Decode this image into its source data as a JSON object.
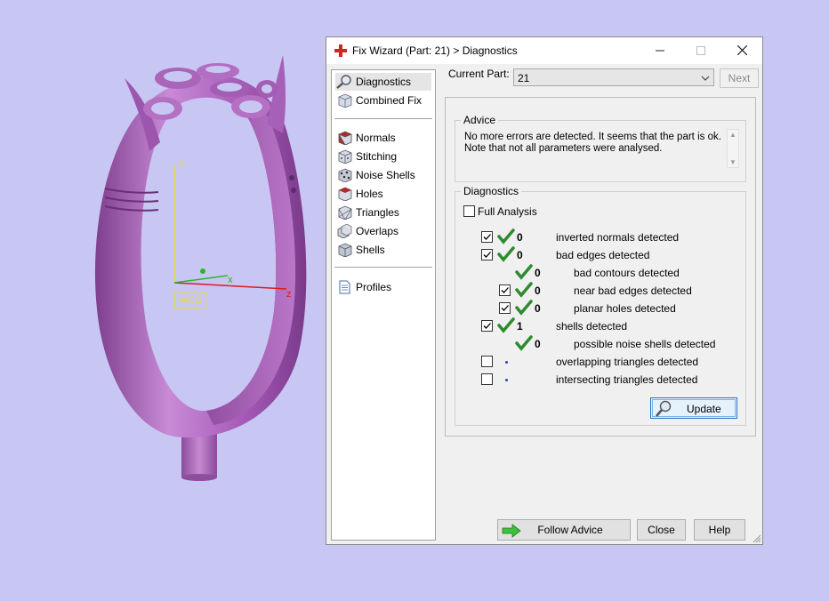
{
  "viewport": {
    "axes": {
      "y": "y",
      "x": "x",
      "z": "z",
      "wcs": "WCS"
    }
  },
  "dialog": {
    "title": "Fix Wizard (Part: 21) > Diagnostics",
    "nav": {
      "top_items": [
        {
          "label": "Diagnostics",
          "icon": "magnifier-icon"
        },
        {
          "label": "Combined Fix",
          "icon": "cube-icon"
        }
      ],
      "tool_items": [
        {
          "label": "Normals",
          "icon": "normals-cube-icon"
        },
        {
          "label": "Stitching",
          "icon": "stitching-cube-icon"
        },
        {
          "label": "Noise Shells",
          "icon": "noise-shells-icon"
        },
        {
          "label": "Holes",
          "icon": "holes-cube-icon"
        },
        {
          "label": "Triangles",
          "icon": "triangles-icon"
        },
        {
          "label": "Overlaps",
          "icon": "overlaps-icon"
        },
        {
          "label": "Shells",
          "icon": "shells-icon"
        }
      ],
      "bottom_items": [
        {
          "label": "Profiles",
          "icon": "document-icon"
        }
      ]
    },
    "current_part_label": "Current Part:",
    "current_part_value": "21",
    "next_label": "Next",
    "advice": {
      "title": "Advice",
      "text": "No more errors are detected. It seems that the part is ok. Note that not all parameters were analysed."
    },
    "diagnostics": {
      "title": "Diagnostics",
      "full_analysis_label": "Full Analysis",
      "rows": [
        {
          "checked": true,
          "status": "ok",
          "count": "0",
          "label": "inverted normals detected"
        },
        {
          "checked": true,
          "status": "ok",
          "count": "0",
          "label": "bad edges detected"
        },
        {
          "checked": null,
          "status": "ok",
          "count": "0",
          "label": "bad contours detected"
        },
        {
          "checked": true,
          "status": "ok",
          "count": "0",
          "label": "near bad edges detected"
        },
        {
          "checked": true,
          "status": "ok",
          "count": "0",
          "label": "planar holes detected"
        },
        {
          "checked": true,
          "status": "ok",
          "count": "1",
          "label": "shells detected"
        },
        {
          "checked": null,
          "status": "ok",
          "count": "0",
          "label": "possible noise shells detected"
        },
        {
          "checked": false,
          "status": "pending",
          "count": "",
          "label": "overlapping triangles detected"
        },
        {
          "checked": false,
          "status": "pending",
          "count": "",
          "label": "intersecting triangles detected"
        }
      ],
      "update_label": "Update"
    },
    "buttons": {
      "follow_advice": "Follow Advice",
      "close": "Close",
      "help": "Help"
    },
    "colors": {
      "check_green": "#2e8b2e",
      "model_purple": "#b76fc4",
      "background": "#c8c6f2"
    }
  }
}
